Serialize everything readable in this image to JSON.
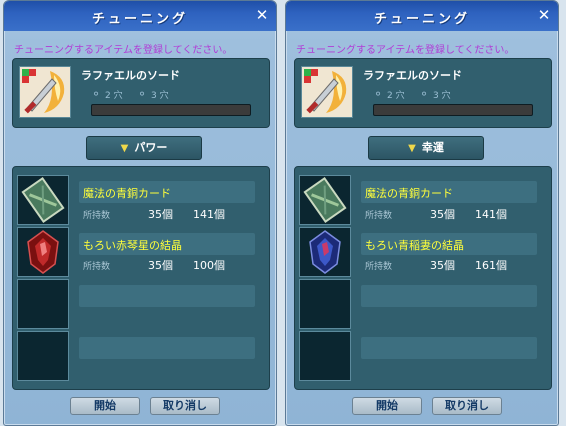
{
  "windows": [
    {
      "title": "チューニング",
      "close": "✕",
      "instruction": "チューニングするアイテムを登録してください。",
      "weapon": {
        "name": "ラファエルのソード",
        "slot_label_1": "2 穴",
        "slot_label_2": "3 穴",
        "progress": 0.0
      },
      "mode_button": {
        "arrow": "▼",
        "label": "パワー"
      },
      "materials": [
        {
          "name": "魔法の青銅カード",
          "sub": "所持数",
          "have": "35個",
          "need": "141個"
        },
        {
          "name": "もろい赤琴星の結晶",
          "sub": "所持数",
          "have": "35個",
          "need": "100個"
        }
      ],
      "buttons": {
        "start": "開始",
        "cancel": "取り消し"
      }
    },
    {
      "title": "チューニング",
      "close": "✕",
      "instruction": "チューニングするアイテムを登録してください。",
      "weapon": {
        "name": "ラファエルのソード",
        "slot_label_1": "2 穴",
        "slot_label_2": "3 穴",
        "progress": 0.0
      },
      "mode_button": {
        "arrow": "▼",
        "label": "幸運"
      },
      "materials": [
        {
          "name": "魔法の青銅カード",
          "sub": "所持数",
          "have": "35個",
          "need": "141個"
        },
        {
          "name": "もろい青稲妻の結晶",
          "sub": "所持数",
          "have": "35個",
          "need": "161個"
        }
      ],
      "buttons": {
        "start": "開始",
        "cancel": "取り消し"
      }
    }
  ],
  "colors": {
    "title_bar": "#2e62bf",
    "instruction": "#b13bd6",
    "material_name": "#ffff3a",
    "panel": "#315f6e"
  }
}
